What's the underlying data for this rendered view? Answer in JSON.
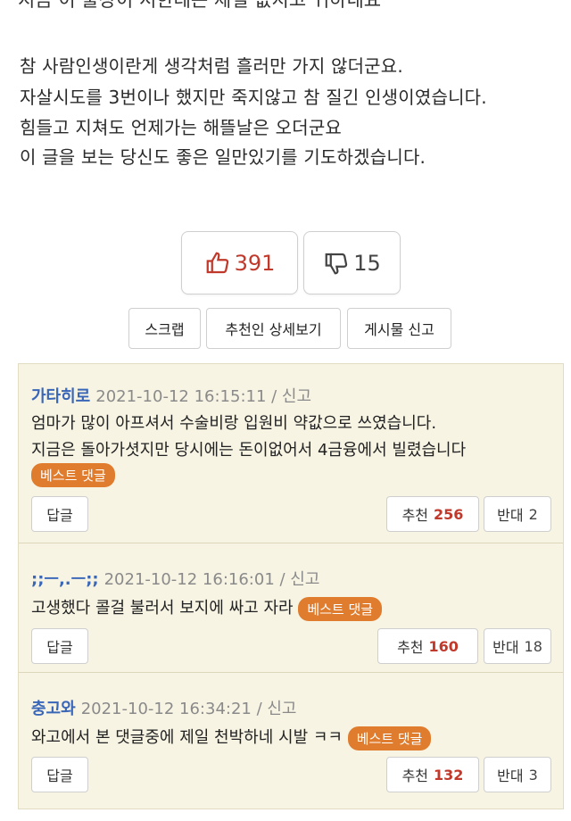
{
  "post": {
    "cut_line": "지금 이 출장이 서한테는 제일 값지고 귀하네요",
    "paragraphs": [
      "참 사람인생이란게 생각처럼 흘러만 가지 않더군요.",
      "자살시도를 3번이나 했지만 죽지않고 참 질긴 인생이였습니다.",
      "힘들고 지쳐도 언제가는 해뜰날은 오더군요",
      "이 글을 보는 당신도 좋은 일만있기를 기도하겠습니다."
    ]
  },
  "votes": {
    "up": "391",
    "down": "15",
    "up_icon": "thumbs-up-icon",
    "down_icon": "thumbs-down-icon"
  },
  "actions": {
    "scrap": "스크랩",
    "recommenders": "추천인 상세보기",
    "report": "게시물 신고"
  },
  "comments": [
    {
      "author": "가타히로",
      "meta": "2021-10-12 16:15:11 / 신고",
      "lines": [
        "엄마가 많이 아프셔서 수술비랑 입원비 약값으로 쓰였습니다.",
        "지금은 돌아가셧지만 당시에는 돈이없어서 4금융에서 빌렸습니다"
      ],
      "badge": "베스트 댓글",
      "reply": "답글",
      "rec_label": "추천",
      "rec_count": "256",
      "opp_label": "반대",
      "opp_count": "2"
    },
    {
      "author": ";;ㅡ,.ㅡ;;",
      "meta": "2021-10-12 16:16:01 / 신고",
      "lines": [
        "고생했다 콜걸 불러서 보지에 싸고 자라"
      ],
      "badge": "베스트 댓글",
      "reply": "답글",
      "rec_label": "추천",
      "rec_count": "160",
      "opp_label": "반대",
      "opp_count": "18"
    },
    {
      "author": "충고와",
      "meta": "2021-10-12 16:34:21 / 신고",
      "lines": [
        "와고에서 본 댓글중에 제일 천박하네 시발 ㅋㅋ"
      ],
      "badge": "베스트 댓글",
      "reply": "답글",
      "rec_label": "추천",
      "rec_count": "132",
      "opp_label": "반대",
      "opp_count": "3"
    }
  ]
}
